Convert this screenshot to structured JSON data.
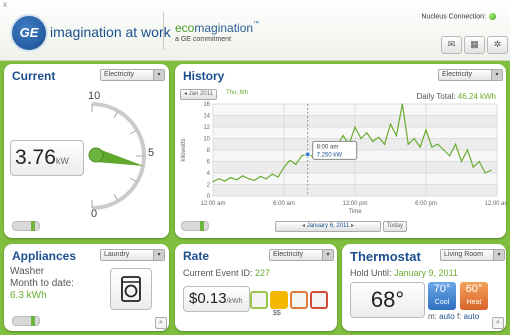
{
  "header": {
    "close_glyph": "x",
    "logo_text": "GE",
    "tagline": "imagination at work",
    "eco_prefix": "eco",
    "eco_main": "magination",
    "eco_tm": "™",
    "eco_sub": "a GE commitment",
    "nucleus_label": "Nucleus Connection:",
    "nucleus_status_color": "#4caf1f",
    "icons": [
      "mail-icon",
      "folder-icon",
      "settings-icon"
    ]
  },
  "current": {
    "title": "Current",
    "dropdown": "Electricity",
    "value": "3.76",
    "unit": "kW",
    "gauge_labels": [
      "10",
      "5",
      "0"
    ],
    "gauge_value": 3.76
  },
  "history": {
    "title": "History",
    "dropdown": "Electricity",
    "prev_label": "◂ Jan 2011",
    "day_label": "Thu, 6th",
    "daily_total_label": "Daily Total:",
    "daily_total_value": "46.24 kWh",
    "ylabel": "kilowatts",
    "xlabel": "Time",
    "tooltip_time": "8:00 am",
    "tooltip_value": "7.250 kW",
    "date_nav": "January 6, 2011",
    "today_btn": "Today"
  },
  "chart_data": {
    "type": "line",
    "title": "",
    "xlabel": "Time",
    "ylabel": "kilowatts",
    "ylim": [
      0,
      16
    ],
    "y_ticks": [
      "16",
      "14",
      "12",
      "10",
      "8",
      "6",
      "4",
      "2",
      "0"
    ],
    "x_ticks": [
      "12:00 am",
      "6:00 am",
      "12:00 pm",
      "6:00 pm",
      "12:00 am"
    ],
    "grid": true,
    "series": [
      {
        "x": [
          0,
          0.5,
          1,
          1.5,
          2,
          2.5,
          3,
          3.5,
          4,
          4.5,
          5,
          5.5,
          6,
          6.5,
          7,
          7.5,
          8,
          8.5,
          9,
          9.5,
          10,
          10.5,
          11,
          11.5,
          12,
          12.5,
          13,
          13.5,
          14,
          14.5,
          15,
          15.5,
          16,
          16.5,
          17,
          17.5,
          18,
          18.5,
          19,
          19.5,
          20,
          20.5,
          21,
          21.5,
          22,
          22.5,
          23,
          23.5
        ],
        "values": [
          2.5,
          3.0,
          2.6,
          3.2,
          2.8,
          3.5,
          3.0,
          2.7,
          3.4,
          3.0,
          3.8,
          3.3,
          5.0,
          6.2,
          5.5,
          7.0,
          7.25,
          6.8,
          7.5,
          8.0,
          7.2,
          8.8,
          10.5,
          9.0,
          12.0,
          10.0,
          11.0,
          9.5,
          10.2,
          9.0,
          12.5,
          10.5,
          16.0,
          9.0,
          10.0,
          8.5,
          11.5,
          8.5,
          9.0,
          8.0,
          7.0,
          9.0,
          6.0,
          8.0,
          5.0,
          6.0,
          4.0,
          4.5
        ]
      }
    ],
    "line_color": "#6aac2f"
  },
  "appliances": {
    "title": "Appliances",
    "dropdown": "Laundry",
    "name": "Washer",
    "mtd_label": "Month to date:",
    "mtd_value": "6.3 kWh"
  },
  "rate": {
    "title": "Rate",
    "dropdown": "Electricity",
    "event_label": "Current Event ID:",
    "event_id": "227",
    "price": "$0.13",
    "price_unit": "/kWh",
    "tier_label": "$$",
    "tier_colors": [
      "#9bc44a",
      "#f5b800",
      "#e07a3a",
      "#d24a3a"
    ]
  },
  "thermostat": {
    "title": "Thermostat",
    "dropdown": "Living Room",
    "hold_label": "Hold Until:",
    "hold_date": "January 9, 2011",
    "temp": "68°",
    "cool_temp": "70°",
    "cool_label": "Cool",
    "heat_temp": "60°",
    "heat_label": "Heat",
    "mode_label": "m:",
    "mode_value": "auto",
    "fan_label": "f:",
    "fan_value": "auto"
  }
}
